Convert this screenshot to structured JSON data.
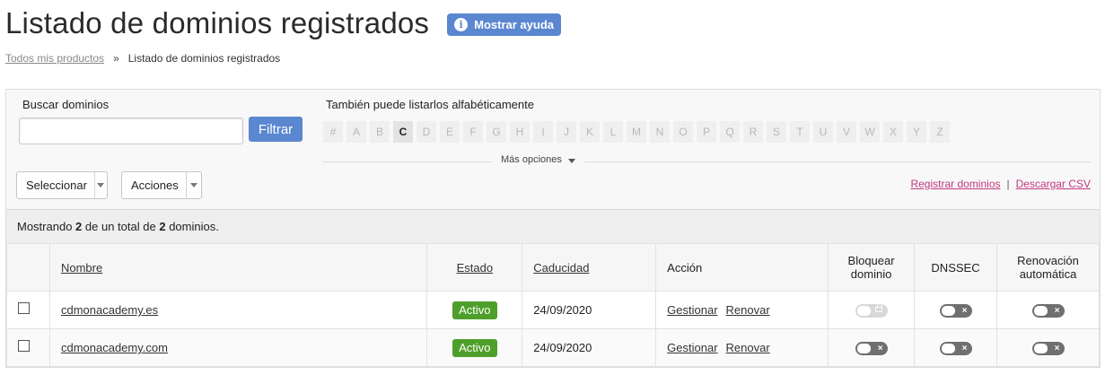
{
  "header": {
    "title": "Listado de dominios registrados",
    "help_label": "Mostrar ayuda",
    "help_icon": "info-icon"
  },
  "breadcrumb": {
    "root": "Todos mis productos",
    "separator": "»",
    "current": "Listado de dominios registrados"
  },
  "search": {
    "label": "Buscar dominios",
    "value": "",
    "placeholder": "",
    "filter_label": "Filtrar"
  },
  "alphabet": {
    "label": "También puede listarlos alfabéticamente",
    "letters": [
      "#",
      "A",
      "B",
      "C",
      "D",
      "E",
      "F",
      "G",
      "H",
      "I",
      "J",
      "K",
      "L",
      "M",
      "N",
      "O",
      "P",
      "Q",
      "R",
      "S",
      "T",
      "U",
      "V",
      "W",
      "X",
      "Y",
      "Z"
    ],
    "active": "C"
  },
  "more_options": "Más opciones",
  "toolbar": {
    "select_label": "Seleccionar",
    "actions_label": "Acciones",
    "register_link": "Registrar dominios",
    "link_separator": "|",
    "csv_link": "Descargar CSV"
  },
  "summary": {
    "prefix": "Mostrando",
    "shown": "2",
    "middle": "de un total de",
    "total": "2",
    "suffix": "dominios."
  },
  "table": {
    "headers": {
      "name": "Nombre",
      "status": "Estado",
      "expiry": "Caducidad",
      "action": "Acción",
      "lock": "Bloquear dominio",
      "dnssec": "DNSSEC",
      "renewal": "Renovación automática"
    },
    "rows": [
      {
        "domain": "cdmonacademy.es",
        "status": "Activo",
        "expiry": "24/09/2020",
        "manage": "Gestionar",
        "renew": "Renovar",
        "lock_toggle": "disabled-locked",
        "dnssec_toggle": "off",
        "renewal_toggle": "off",
        "toggle_off_icon": "×"
      },
      {
        "domain": "cdmonacademy.com",
        "status": "Activo",
        "expiry": "24/09/2020",
        "manage": "Gestionar",
        "renew": "Renovar",
        "lock_toggle": "off",
        "dnssec_toggle": "off",
        "renewal_toggle": "off",
        "toggle_off_icon": "×"
      }
    ]
  },
  "colors": {
    "primary_button": "#5b87d0",
    "status_active": "#4e9f2a",
    "link_accent": "#c2387f"
  }
}
